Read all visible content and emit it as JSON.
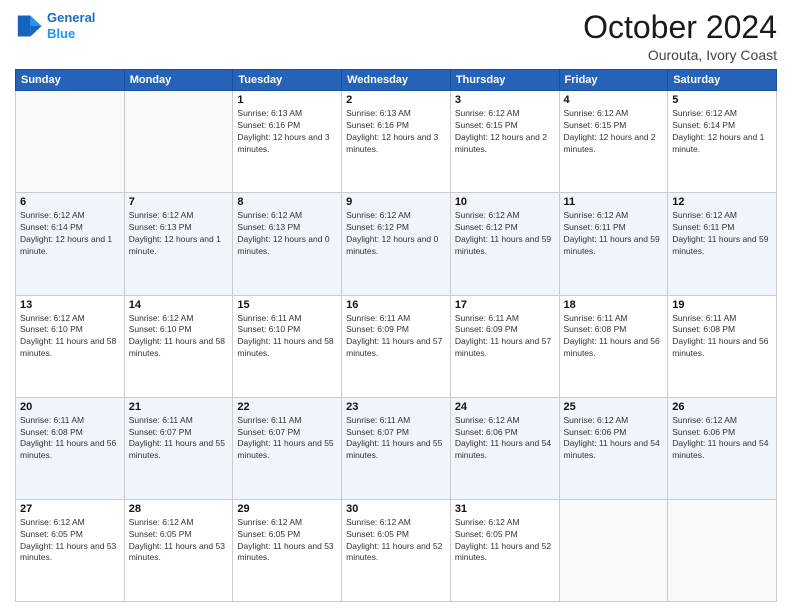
{
  "header": {
    "logo_line1": "General",
    "logo_line2": "Blue",
    "month": "October 2024",
    "location": "Ourouta, Ivory Coast"
  },
  "days_of_week": [
    "Sunday",
    "Monday",
    "Tuesday",
    "Wednesday",
    "Thursday",
    "Friday",
    "Saturday"
  ],
  "weeks": [
    [
      {
        "day": "",
        "info": ""
      },
      {
        "day": "",
        "info": ""
      },
      {
        "day": "1",
        "info": "Sunrise: 6:13 AM\nSunset: 6:16 PM\nDaylight: 12 hours and 3 minutes."
      },
      {
        "day": "2",
        "info": "Sunrise: 6:13 AM\nSunset: 6:16 PM\nDaylight: 12 hours and 3 minutes."
      },
      {
        "day": "3",
        "info": "Sunrise: 6:12 AM\nSunset: 6:15 PM\nDaylight: 12 hours and 2 minutes."
      },
      {
        "day": "4",
        "info": "Sunrise: 6:12 AM\nSunset: 6:15 PM\nDaylight: 12 hours and 2 minutes."
      },
      {
        "day": "5",
        "info": "Sunrise: 6:12 AM\nSunset: 6:14 PM\nDaylight: 12 hours and 1 minute."
      }
    ],
    [
      {
        "day": "6",
        "info": "Sunrise: 6:12 AM\nSunset: 6:14 PM\nDaylight: 12 hours and 1 minute."
      },
      {
        "day": "7",
        "info": "Sunrise: 6:12 AM\nSunset: 6:13 PM\nDaylight: 12 hours and 1 minute."
      },
      {
        "day": "8",
        "info": "Sunrise: 6:12 AM\nSunset: 6:13 PM\nDaylight: 12 hours and 0 minutes."
      },
      {
        "day": "9",
        "info": "Sunrise: 6:12 AM\nSunset: 6:12 PM\nDaylight: 12 hours and 0 minutes."
      },
      {
        "day": "10",
        "info": "Sunrise: 6:12 AM\nSunset: 6:12 PM\nDaylight: 11 hours and 59 minutes."
      },
      {
        "day": "11",
        "info": "Sunrise: 6:12 AM\nSunset: 6:11 PM\nDaylight: 11 hours and 59 minutes."
      },
      {
        "day": "12",
        "info": "Sunrise: 6:12 AM\nSunset: 6:11 PM\nDaylight: 11 hours and 59 minutes."
      }
    ],
    [
      {
        "day": "13",
        "info": "Sunrise: 6:12 AM\nSunset: 6:10 PM\nDaylight: 11 hours and 58 minutes."
      },
      {
        "day": "14",
        "info": "Sunrise: 6:12 AM\nSunset: 6:10 PM\nDaylight: 11 hours and 58 minutes."
      },
      {
        "day": "15",
        "info": "Sunrise: 6:11 AM\nSunset: 6:10 PM\nDaylight: 11 hours and 58 minutes."
      },
      {
        "day": "16",
        "info": "Sunrise: 6:11 AM\nSunset: 6:09 PM\nDaylight: 11 hours and 57 minutes."
      },
      {
        "day": "17",
        "info": "Sunrise: 6:11 AM\nSunset: 6:09 PM\nDaylight: 11 hours and 57 minutes."
      },
      {
        "day": "18",
        "info": "Sunrise: 6:11 AM\nSunset: 6:08 PM\nDaylight: 11 hours and 56 minutes."
      },
      {
        "day": "19",
        "info": "Sunrise: 6:11 AM\nSunset: 6:08 PM\nDaylight: 11 hours and 56 minutes."
      }
    ],
    [
      {
        "day": "20",
        "info": "Sunrise: 6:11 AM\nSunset: 6:08 PM\nDaylight: 11 hours and 56 minutes."
      },
      {
        "day": "21",
        "info": "Sunrise: 6:11 AM\nSunset: 6:07 PM\nDaylight: 11 hours and 55 minutes."
      },
      {
        "day": "22",
        "info": "Sunrise: 6:11 AM\nSunset: 6:07 PM\nDaylight: 11 hours and 55 minutes."
      },
      {
        "day": "23",
        "info": "Sunrise: 6:11 AM\nSunset: 6:07 PM\nDaylight: 11 hours and 55 minutes."
      },
      {
        "day": "24",
        "info": "Sunrise: 6:12 AM\nSunset: 6:06 PM\nDaylight: 11 hours and 54 minutes."
      },
      {
        "day": "25",
        "info": "Sunrise: 6:12 AM\nSunset: 6:06 PM\nDaylight: 11 hours and 54 minutes."
      },
      {
        "day": "26",
        "info": "Sunrise: 6:12 AM\nSunset: 6:06 PM\nDaylight: 11 hours and 54 minutes."
      }
    ],
    [
      {
        "day": "27",
        "info": "Sunrise: 6:12 AM\nSunset: 6:05 PM\nDaylight: 11 hours and 53 minutes."
      },
      {
        "day": "28",
        "info": "Sunrise: 6:12 AM\nSunset: 6:05 PM\nDaylight: 11 hours and 53 minutes."
      },
      {
        "day": "29",
        "info": "Sunrise: 6:12 AM\nSunset: 6:05 PM\nDaylight: 11 hours and 53 minutes."
      },
      {
        "day": "30",
        "info": "Sunrise: 6:12 AM\nSunset: 6:05 PM\nDaylight: 11 hours and 52 minutes."
      },
      {
        "day": "31",
        "info": "Sunrise: 6:12 AM\nSunset: 6:05 PM\nDaylight: 11 hours and 52 minutes."
      },
      {
        "day": "",
        "info": ""
      },
      {
        "day": "",
        "info": ""
      }
    ]
  ]
}
